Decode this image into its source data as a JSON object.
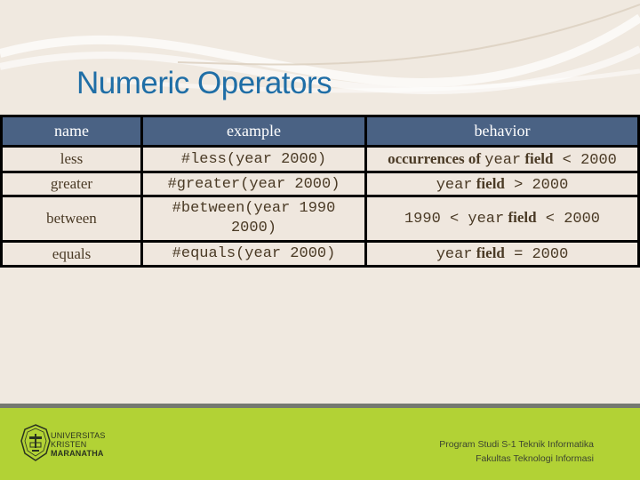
{
  "slide": {
    "title": "Numeric Operators"
  },
  "table": {
    "headers": [
      "name",
      "example",
      "behavior"
    ],
    "rows": [
      {
        "name": "less",
        "example": "#less(year 2000)",
        "behavior": {
          "prefix": "occurrences of ",
          "field": "year",
          "field_word": " field",
          "op": " < ",
          "value": "2000",
          "lower": ""
        }
      },
      {
        "name": "greater",
        "example": "#greater(year 2000)",
        "behavior": {
          "prefix": "",
          "field": "year",
          "field_word": " field",
          "op": " > ",
          "value": "2000",
          "lower": ""
        }
      },
      {
        "name": "between",
        "example_line1": "#between(year 1990",
        "example_line2": "2000)",
        "behavior": {
          "lower": "1990 < ",
          "field": "year",
          "field_word": " field",
          "op": " < ",
          "value": "2000"
        }
      },
      {
        "name": "equals",
        "example": "#equals(year 2000)",
        "behavior": {
          "prefix": "",
          "field": "year",
          "field_word": " field",
          "op": " = ",
          "value": "2000",
          "lower": ""
        }
      }
    ]
  },
  "footer": {
    "university_line1": "UNIVERSITAS",
    "university_line2": "KRISTEN",
    "university_line3": "MARANATHA",
    "program": "Program Studi S-1 Teknik Informatika",
    "faculty": "Fakultas Teknologi Informasi"
  },
  "colors": {
    "title": "#1f6ea6",
    "header_bg": "#4a6284",
    "footer_green": "#b2d235"
  }
}
